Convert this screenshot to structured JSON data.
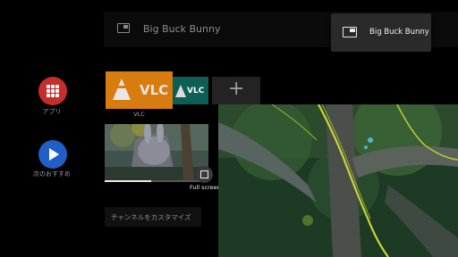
{
  "search_bar": {
    "title": "Big Buck Bunny"
  },
  "pip_popup": {
    "label": "Big Buck Bunny"
  },
  "rail": {
    "apps_label": "アプリ",
    "recommend_label": "次のおすすめ"
  },
  "apps": {
    "vlc_tile_text": "VLC",
    "vlc_label": "VLC",
    "vlc_tile2_text": "VLC",
    "add_symbol": "+"
  },
  "preview": {
    "fullscreen_label": "Full screen",
    "progress_fraction": 0.45
  },
  "customize_label": "チャンネルをカスタマイズ",
  "colors": {
    "apps_button": "#c62e2e",
    "recommend_button": "#1f5fc6",
    "vlc_orange": "#f08a12"
  }
}
